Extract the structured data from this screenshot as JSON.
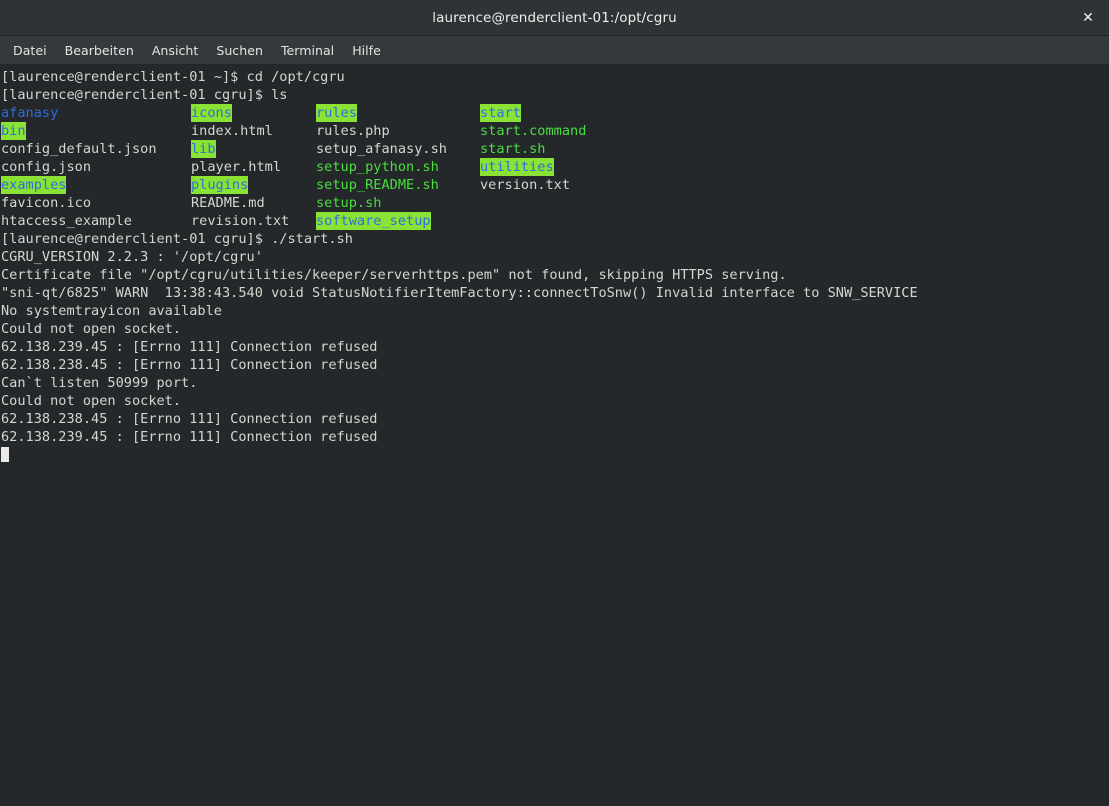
{
  "window": {
    "title": "laurence@renderclient-01:/opt/cgru",
    "close_label": "✕"
  },
  "menubar": {
    "items": [
      {
        "label": "Datei"
      },
      {
        "label": "Bearbeiten"
      },
      {
        "label": "Ansicht"
      },
      {
        "label": "Suchen"
      },
      {
        "label": "Terminal"
      },
      {
        "label": "Hilfe"
      }
    ]
  },
  "colors": {
    "terminal_background": "#24282a",
    "titlebar_background": "#2e3436",
    "menubar_background": "#343a3c",
    "foreground": "#d3d7cf",
    "executable_green": "#4ade3f",
    "directory_text": "#2b6fdd",
    "directory_highlight": "#8ae234",
    "cursor": "#e8e8e6"
  },
  "terminal": {
    "prompt_1": "[laurence@renderclient-01 ~]$ cd /opt/cgru",
    "prompt_2": "[laurence@renderclient-01 cgru]$ ls",
    "prompt_3": "[laurence@renderclient-01 cgru]$ ./start.sh",
    "ls_rows": [
      [
        {
          "name": "afanasy",
          "type": "dir-plain"
        },
        {
          "name": "icons",
          "type": "dir"
        },
        {
          "name": "rules",
          "type": "dir"
        },
        {
          "name": "start",
          "type": "dir"
        }
      ],
      [
        {
          "name": "bin",
          "type": "dir"
        },
        {
          "name": "index.html",
          "type": "plain"
        },
        {
          "name": "rules.php",
          "type": "plain"
        },
        {
          "name": "start.command",
          "type": "exec"
        }
      ],
      [
        {
          "name": "config_default.json",
          "type": "plain"
        },
        {
          "name": "lib",
          "type": "dir"
        },
        {
          "name": "setup_afanasy.sh",
          "type": "plain"
        },
        {
          "name": "start.sh",
          "type": "exec"
        }
      ],
      [
        {
          "name": "config.json",
          "type": "plain"
        },
        {
          "name": "player.html",
          "type": "plain"
        },
        {
          "name": "setup_python.sh",
          "type": "exec"
        },
        {
          "name": "utilities",
          "type": "dir"
        }
      ],
      [
        {
          "name": "examples",
          "type": "dir"
        },
        {
          "name": "plugins",
          "type": "dir"
        },
        {
          "name": "setup_README.sh",
          "type": "exec"
        },
        {
          "name": "version.txt",
          "type": "plain"
        }
      ],
      [
        {
          "name": "favicon.ico",
          "type": "plain"
        },
        {
          "name": "README.md",
          "type": "plain"
        },
        {
          "name": "setup.sh",
          "type": "exec"
        },
        {
          "name": "",
          "type": "plain"
        }
      ],
      [
        {
          "name": "htaccess_example",
          "type": "plain"
        },
        {
          "name": "revision.txt",
          "type": "plain"
        },
        {
          "name": "software_setup",
          "type": "dir"
        },
        {
          "name": "",
          "type": "plain"
        }
      ]
    ],
    "output_lines": [
      "CGRU_VERSION 2.2.3 : '/opt/cgru'",
      "Certificate file \"/opt/cgru/utilities/keeper/serverhttps.pem\" not found, skipping HTTPS serving.",
      "\"sni-qt/6825\" WARN  13:38:43.540 void StatusNotifierItemFactory::connectToSnw() Invalid interface to SNW_SERVICE",
      "No systemtrayicon available",
      "Could not open socket.",
      "62.138.239.45 : [Errno 111] Connection refused",
      "62.138.238.45 : [Errno 111] Connection refused",
      "Can`t listen 50999 port.",
      "Could not open socket.",
      "62.138.238.45 : [Errno 111] Connection refused",
      "62.138.239.45 : [Errno 111] Connection refused"
    ]
  }
}
